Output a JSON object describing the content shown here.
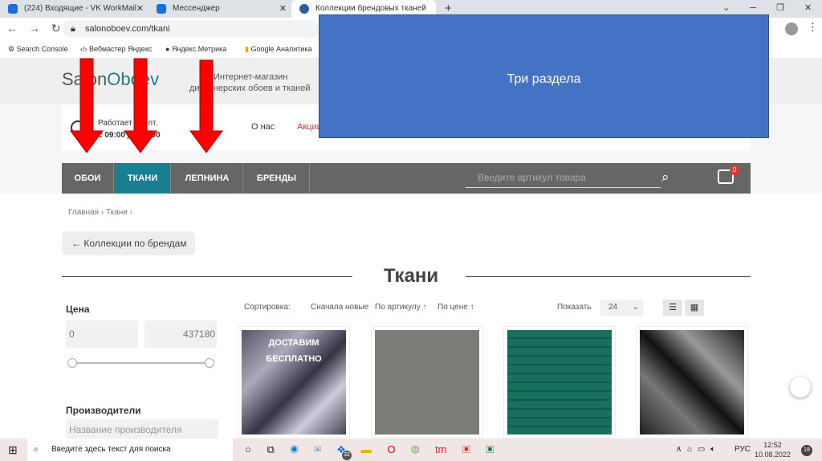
{
  "browser": {
    "tabs": [
      {
        "title": "(224) Входящие - VK WorkMail"
      },
      {
        "title": "Мессенджер"
      },
      {
        "title": "Коллекции брендовых тканей"
      }
    ],
    "new_tab": "+",
    "url": "salonoboev.com/tkani",
    "bookmarks": [
      "Search Console",
      "Вебмастер Яндекс",
      "Яндекс.Метрика",
      "Google Аналитика"
    ]
  },
  "site": {
    "logo_a": "Sal",
    "logo_hidden": "on",
    "logo_b": "Obo",
    "logo_c": "ev",
    "logo_full": "SalonOboev",
    "tagline1": "Интернет-магазин",
    "tagline2": "дизайнерских обоев и тканей",
    "hours1": "Работает пн.-пт.",
    "hours2": "с 09:00 до 18:00",
    "about": "О нас",
    "promo": "Акции",
    "nav": [
      "ОБОИ",
      "ТКАНИ",
      "ЛЕПНИНА",
      "БРЕНДЫ"
    ],
    "search_placeholder": "Введите артикул товара",
    "cart_count": "0",
    "breadcrumbs": [
      "Главная",
      "Ткани"
    ],
    "back_button": "← Коллекции по брендам",
    "heading": "Ткани",
    "filters": {
      "price_label": "Цена",
      "price_min": "0",
      "price_max": "437180",
      "brands_label": "Производители",
      "brands_placeholder": "Название производителя"
    },
    "sort": {
      "label": "Сортировка:",
      "options": [
        "Сначала новые",
        "По артикулу ↑",
        "По цене ↑"
      ],
      "show_label": "Показать",
      "show_value": "24"
    },
    "products": [
      {
        "badge1": "ДОСТАВИМ",
        "badge2": "БЕСПЛАТНО"
      }
    ]
  },
  "overlay": {
    "text": "Три раздела"
  },
  "taskbar": {
    "search_placeholder": "Введите здесь текст для поиска",
    "mail_badge": "32",
    "lang": "РУС",
    "time": "12:52",
    "date": "10.08.2022",
    "notif": "18"
  }
}
